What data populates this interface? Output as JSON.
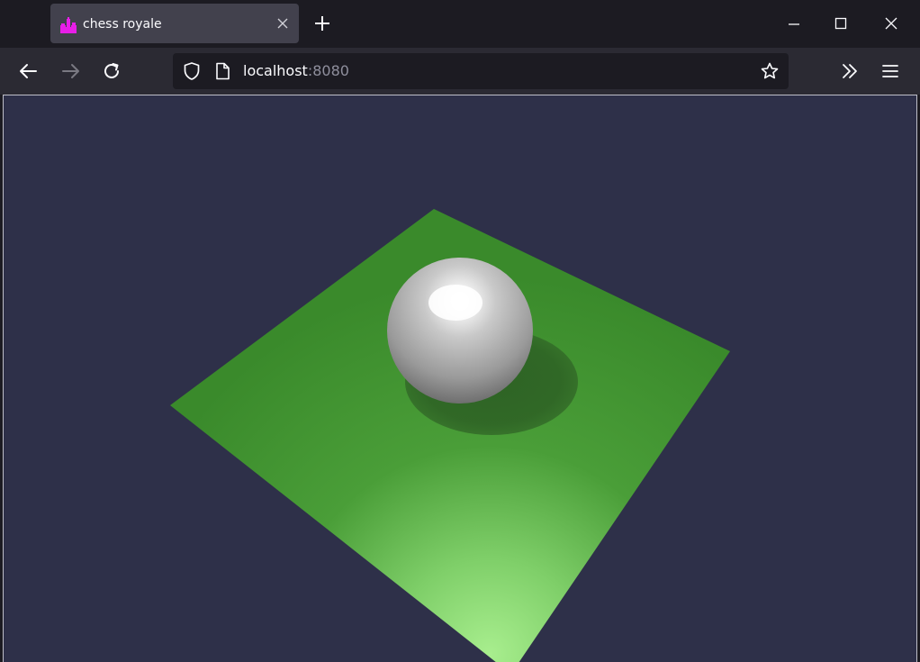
{
  "browser": {
    "tab": {
      "title": "chess royale",
      "favicon": "chess-pieces-icon",
      "favicon_color": "#e81ee8"
    },
    "url": {
      "host": "localhost",
      "port": ":8080"
    },
    "icons": {
      "back": "back-arrow-icon",
      "forward": "forward-arrow-icon",
      "reload": "reload-icon",
      "shield": "shield-icon",
      "page": "page-icon",
      "bookmark": "star-icon",
      "overflow": "chevron-double-right-icon",
      "menu": "hamburger-menu-icon",
      "new_tab": "plus-icon",
      "close_tab": "close-icon",
      "minimize": "minimize-icon",
      "maximize": "maximize-icon",
      "close_window": "close-icon"
    }
  },
  "scene": {
    "background_color": "#2e3049",
    "ground_color": "#3b8a2c",
    "ground_highlight_color": "#a8ee8e",
    "sphere_color": "#c8c8c8",
    "shadow_color": "#2a5a20"
  }
}
